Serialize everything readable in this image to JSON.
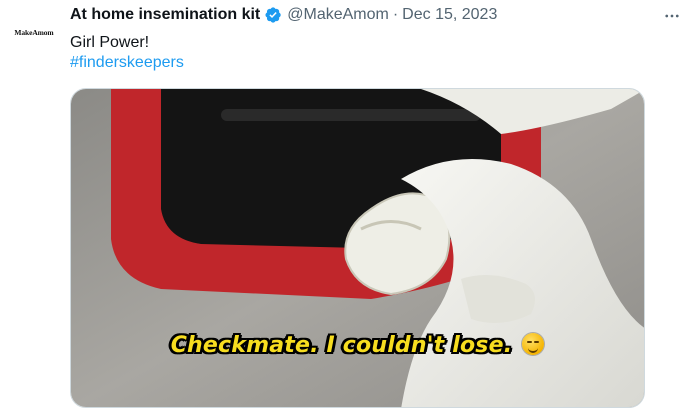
{
  "avatar": {
    "text": "MakeAmom"
  },
  "tweet": {
    "display_name": "At home insemination kit",
    "handle": "@MakeAmom",
    "separator": "·",
    "date": "Dec 15, 2023",
    "text": "Girl Power!",
    "hashtag": "#finderskeepers",
    "more_icon": "more-horizontal-icon",
    "verified_icon": "verified-badge-icon"
  },
  "media": {
    "caption": "Checkmate. I couldn't lose.",
    "caption_emoji": "smirk-emoji",
    "caption_color": "#f7dd1f"
  },
  "colors": {
    "link": "#1d9bf0",
    "secondary": "#536471",
    "verified": "#1d9bf0"
  }
}
